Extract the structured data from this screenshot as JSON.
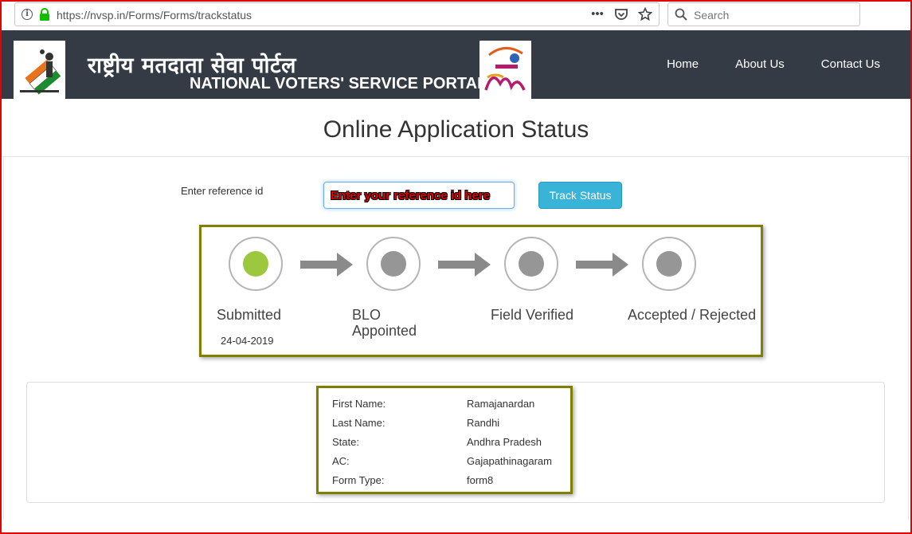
{
  "browser": {
    "url": "https://nvsp.in/Forms/Forms/trackstatus",
    "search_placeholder": "Search"
  },
  "header": {
    "title_hindi": "राष्ट्रीय मतदाता सेवा पोर्टल",
    "title_english": "NATIONAL VOTERS' SERVICE PORTAL",
    "nav": [
      "Home",
      "About Us",
      "Contact Us"
    ]
  },
  "page": {
    "title": "Online Application Status"
  },
  "form": {
    "label": "Enter reference id",
    "placeholder": "Enter your reference id here",
    "button": "Track Status"
  },
  "tracker": {
    "steps": [
      {
        "label": "Submitted",
        "date": "24-04-2019",
        "status": "done"
      },
      {
        "label_line1": "BLO",
        "label_line2": "Appointed",
        "status": "pending"
      },
      {
        "label": "Field Verified",
        "status": "pending"
      },
      {
        "label": "Accepted / Rejected",
        "status": "pending"
      }
    ]
  },
  "details": {
    "rows": [
      {
        "key": "First Name:",
        "value": "Ramajanardan"
      },
      {
        "key": "Last Name:",
        "value": "Randhi"
      },
      {
        "key": "State:",
        "value": "Andhra Pradesh"
      },
      {
        "key": "AC:",
        "value": "Gajapathinagaram"
      },
      {
        "key": "Form Type:",
        "value": "form8"
      }
    ]
  },
  "colors": {
    "header_bg": "#353b45",
    "step_done": "#9bc83c",
    "step_pending": "#969696",
    "highlight_border": "#808000",
    "button_bg": "#39b3d7"
  },
  "icons": [
    "info-icon",
    "lock-icon",
    "more-icon",
    "pocket-icon",
    "bookmark-star-icon",
    "search-icon"
  ]
}
